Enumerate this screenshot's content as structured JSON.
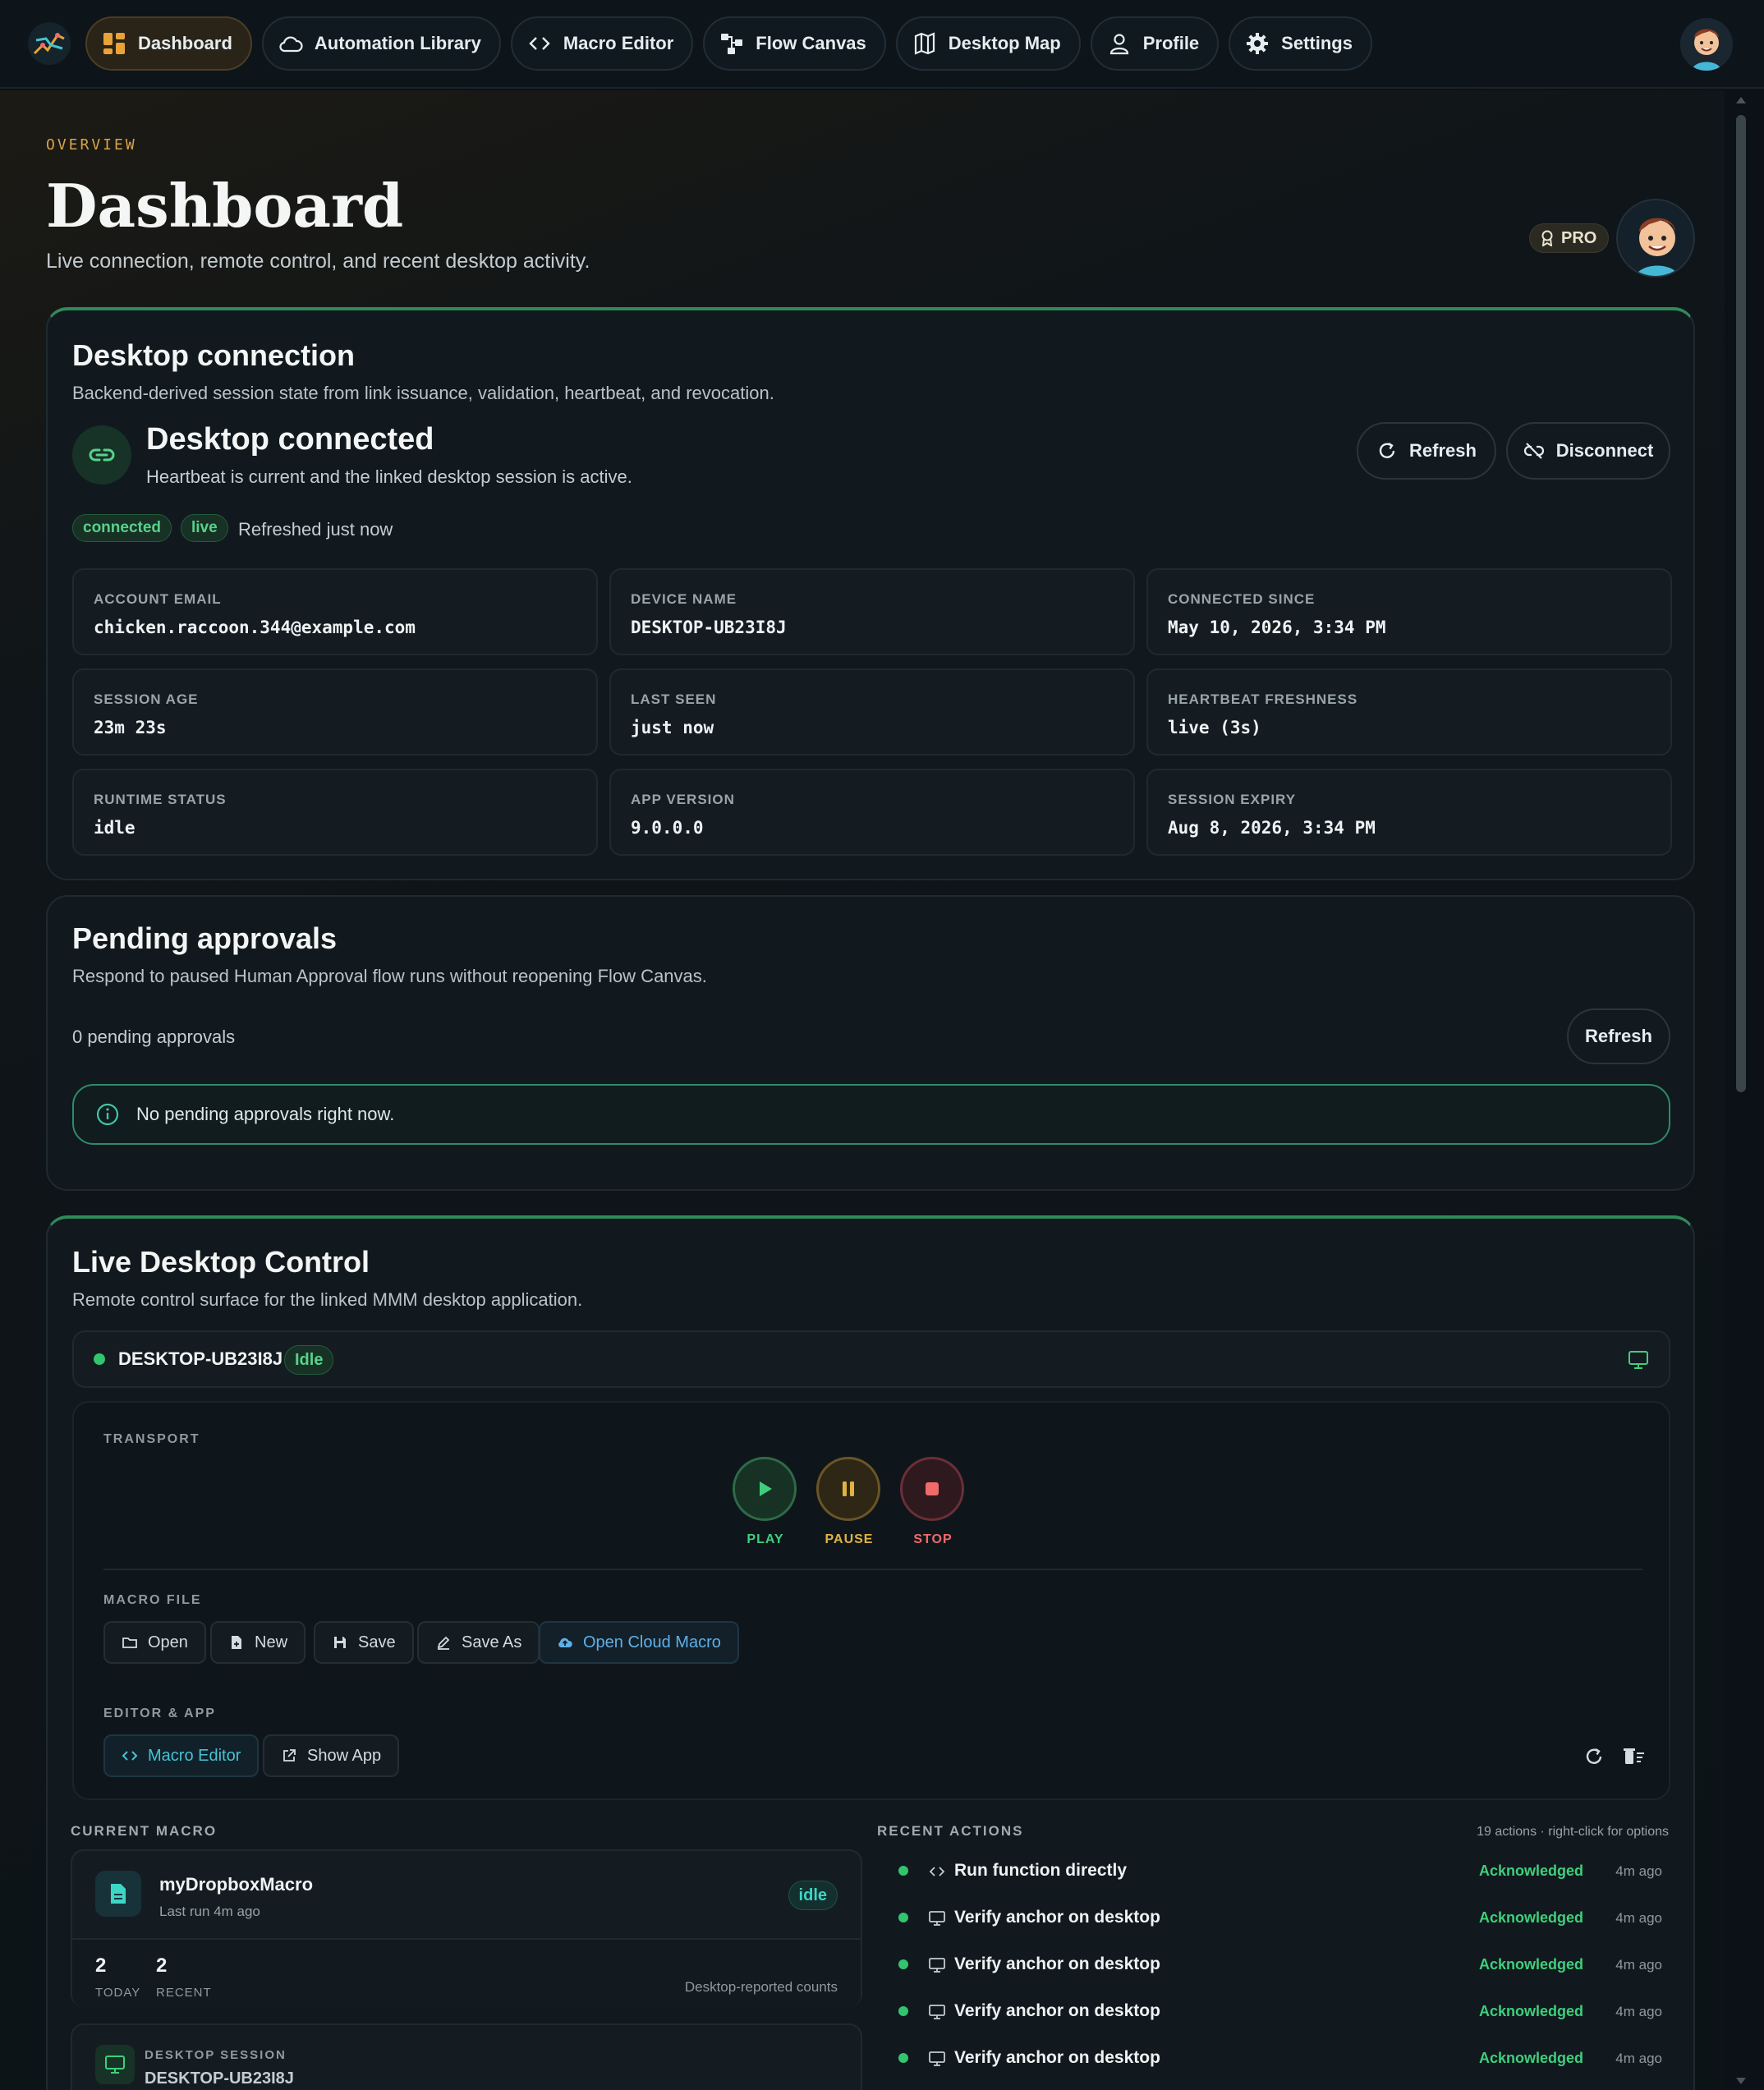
{
  "nav": {
    "items": [
      {
        "label": "Dashboard",
        "icon": "grid-icon"
      },
      {
        "label": "Automation Library",
        "icon": "cloud-icon"
      },
      {
        "label": "Macro Editor",
        "icon": "code-icon"
      },
      {
        "label": "Flow Canvas",
        "icon": "flow-icon"
      },
      {
        "label": "Desktop Map",
        "icon": "map-icon"
      },
      {
        "label": "Profile",
        "icon": "user-icon"
      },
      {
        "label": "Settings",
        "icon": "gear-icon"
      }
    ]
  },
  "header": {
    "overline": "OVERVIEW",
    "title": "Dashboard",
    "subtitle": "Live connection, remote control, and recent desktop activity.",
    "badge": "PRO"
  },
  "connection": {
    "title": "Desktop connection",
    "subtitle": "Backend-derived session state from link issuance, validation, heartbeat, and revocation.",
    "status_title": "Desktop connected",
    "status_sub": "Heartbeat is current and the linked desktop session is active.",
    "refresh_label": "Refresh",
    "disconnect_label": "Disconnect",
    "tags": [
      "connected",
      "live"
    ],
    "refreshed_text": "Refreshed just now",
    "fields": [
      {
        "key": "ACCOUNT EMAIL",
        "value": "chicken.raccoon.344@example.com"
      },
      {
        "key": "DEVICE NAME",
        "value": "DESKTOP-UB23I8J"
      },
      {
        "key": "CONNECTED SINCE",
        "value": "May 10, 2026, 3:34 PM"
      },
      {
        "key": "SESSION AGE",
        "value": "23m 23s"
      },
      {
        "key": "LAST SEEN",
        "value": "just now"
      },
      {
        "key": "HEARTBEAT FRESHNESS",
        "value": "live (3s)"
      },
      {
        "key": "RUNTIME STATUS",
        "value": "idle"
      },
      {
        "key": "APP VERSION",
        "value": "9.0.0.0"
      },
      {
        "key": "SESSION EXPIRY",
        "value": "Aug 8, 2026, 3:34 PM"
      }
    ]
  },
  "approvals": {
    "title": "Pending approvals",
    "subtitle": "Respond to paused Human Approval flow runs without reopening Flow Canvas.",
    "count_text": "0 pending approvals",
    "refresh_label": "Refresh",
    "empty_text": "No pending approvals right now."
  },
  "control": {
    "title": "Live Desktop Control",
    "subtitle": "Remote control surface for the linked MMM desktop application.",
    "device_name": "DESKTOP-UB23I8J",
    "device_state": "Idle",
    "transport_label": "TRANSPORT",
    "play_label": "PLAY",
    "pause_label": "PAUSE",
    "stop_label": "STOP",
    "macro_file_label": "MACRO FILE",
    "file_buttons": [
      "Open",
      "New",
      "Save",
      "Save As",
      "Open Cloud Macro"
    ],
    "editor_app_label": "EDITOR & APP",
    "editor_buttons": [
      "Macro Editor",
      "Show App"
    ],
    "colors": {
      "play": "#3fcf7c",
      "pause": "#e0b340",
      "stop": "#f06a6a"
    }
  },
  "current_macro": {
    "label": "CURRENT MACRO",
    "name": "myDropboxMacro",
    "last_run": "Last run 4m ago",
    "state": "idle",
    "today_count": "2",
    "today_label": "TODAY",
    "recent_count": "2",
    "recent_label": "RECENT",
    "note": "Desktop-reported counts",
    "session_label": "DESKTOP SESSION",
    "session_device": "DESKTOP-UB23I8J"
  },
  "recent_actions": {
    "label": "RECENT ACTIONS",
    "meta": "19 actions · right-click for options",
    "items": [
      {
        "text": "Run function directly",
        "icon": "code-icon",
        "status": "Acknowledged",
        "time": "4m ago"
      },
      {
        "text": "Verify anchor on desktop",
        "icon": "monitor-icon",
        "status": "Acknowledged",
        "time": "4m ago"
      },
      {
        "text": "Verify anchor on desktop",
        "icon": "monitor-icon",
        "status": "Acknowledged",
        "time": "4m ago"
      },
      {
        "text": "Verify anchor on desktop",
        "icon": "monitor-icon",
        "status": "Acknowledged",
        "time": "4m ago"
      },
      {
        "text": "Verify anchor on desktop",
        "icon": "monitor-icon",
        "status": "Acknowledged",
        "time": "4m ago"
      }
    ]
  }
}
